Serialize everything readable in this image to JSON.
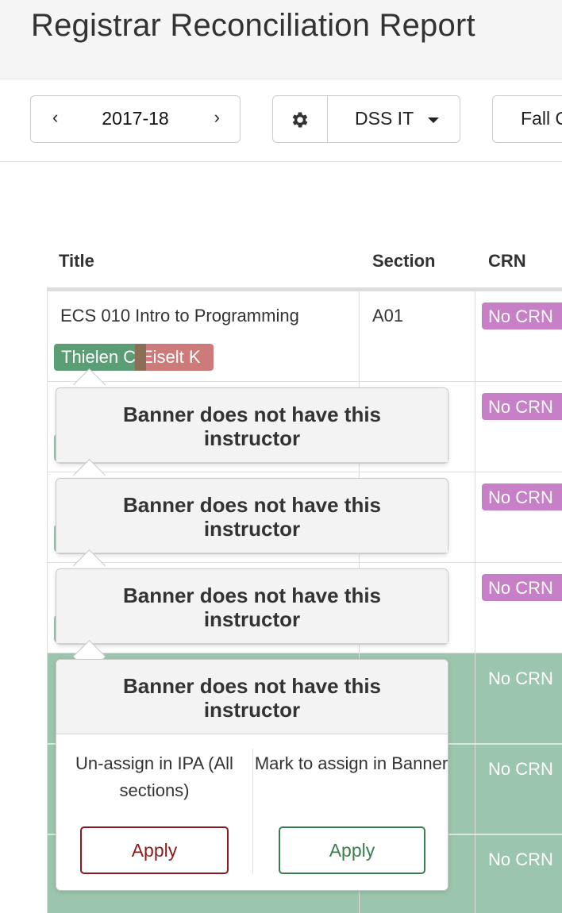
{
  "header": {
    "title": "Registrar Reconciliation Report"
  },
  "toolbar": {
    "year": "2017-18",
    "prev_icon": "‹",
    "next_icon": "›",
    "settings_icon": "gear-icon",
    "department": "DSS IT",
    "term": "Fall Q"
  },
  "table": {
    "columns": [
      "Title",
      "Section",
      "CRN"
    ],
    "rows": [
      {
        "title": "ECS 010 Intro to Programming",
        "section": "A01",
        "crn": "No CRN",
        "instructors": [
          "Thielen C",
          "Eiselt K"
        ]
      },
      {
        "crn": "No CRN"
      },
      {
        "crn": "No CRN"
      },
      {
        "crn": "No CRN"
      },
      {
        "crn": "No CRN"
      },
      {
        "crn": "No CRN"
      },
      {
        "crn": "No CRN"
      }
    ]
  },
  "popovers": [
    {
      "title": "Banner does not have this instructor"
    },
    {
      "title": "Banner does not have this instructor"
    },
    {
      "title": "Banner does not have this instructor"
    },
    {
      "title": "Banner does not have this instructor",
      "left_option": "Un-assign in IPA (All sections)",
      "left_button": "Apply",
      "right_option": "Mark to assign in Banner",
      "right_button": "Apply"
    }
  ],
  "colors": {
    "crn_badge": "#c77fc7",
    "instructor_ok": "#5b9e76",
    "instructor_missing": "#cc7a7a",
    "row_highlight": "#9bc6ad",
    "apply_red": "#8b1a1a",
    "apply_green": "#3a7d4f"
  }
}
